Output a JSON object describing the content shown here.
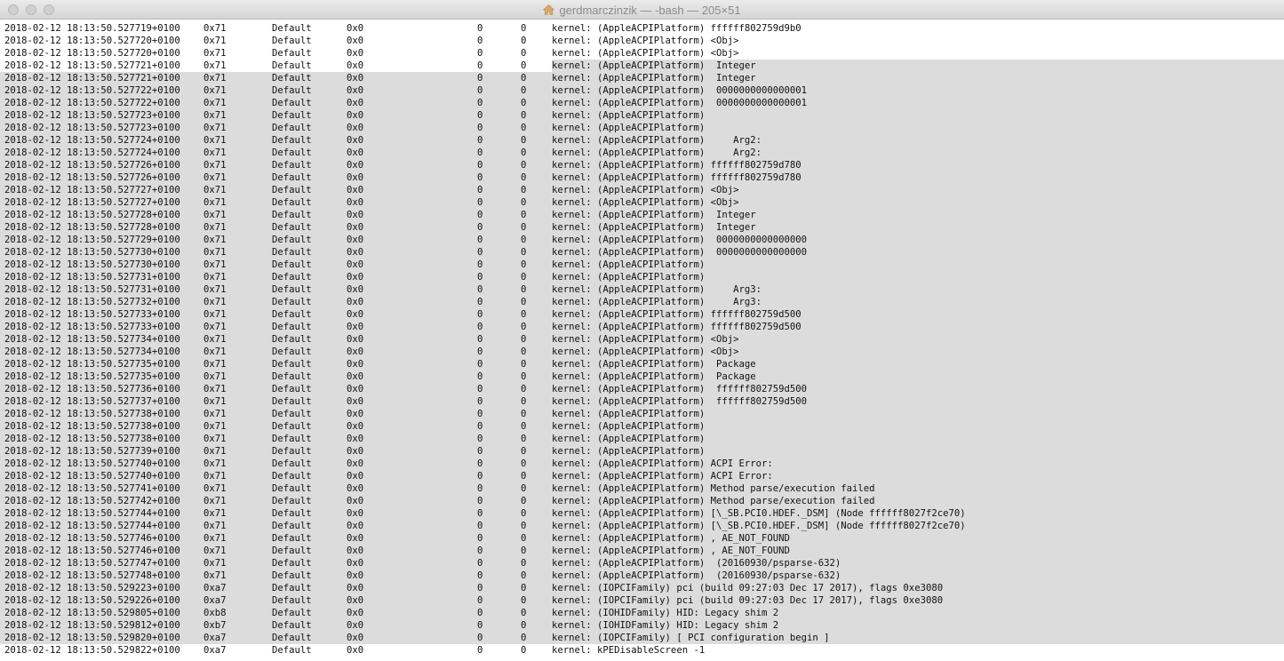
{
  "window": {
    "title": "gerdmarczinzik — -bash — 205×51"
  },
  "terminal": {
    "selection": {
      "partial_lines": [
        3
      ],
      "full_lines_from": 4,
      "full_lines_to": 49
    },
    "lines": [
      [
        "2018-02-12 18:13:50.527719+0100",
        "0x71",
        "Default",
        "0x0",
        "0",
        "0",
        "kernel: (AppleACPIPlatform) ffffff802759d9b0"
      ],
      [
        "2018-02-12 18:13:50.527720+0100",
        "0x71",
        "Default",
        "0x0",
        "0",
        "0",
        "kernel: (AppleACPIPlatform) <Obj>"
      ],
      [
        "2018-02-12 18:13:50.527720+0100",
        "0x71",
        "Default",
        "0x0",
        "0",
        "0",
        "kernel: (AppleACPIPlatform) <Obj>"
      ],
      [
        "2018-02-12 18:13:50.527721+0100",
        "0x71",
        "Default",
        "0x0",
        "0",
        "0",
        "kernel: (AppleACPIPlatform)  Integer"
      ],
      [
        "2018-02-12 18:13:50.527721+0100",
        "0x71",
        "Default",
        "0x0",
        "0",
        "0",
        "kernel: (AppleACPIPlatform)  Integer"
      ],
      [
        "2018-02-12 18:13:50.527722+0100",
        "0x71",
        "Default",
        "0x0",
        "0",
        "0",
        "kernel: (AppleACPIPlatform)  0000000000000001"
      ],
      [
        "2018-02-12 18:13:50.527722+0100",
        "0x71",
        "Default",
        "0x0",
        "0",
        "0",
        "kernel: (AppleACPIPlatform)  0000000000000001"
      ],
      [
        "2018-02-12 18:13:50.527723+0100",
        "0x71",
        "Default",
        "0x0",
        "0",
        "0",
        "kernel: (AppleACPIPlatform)"
      ],
      [
        "2018-02-12 18:13:50.527723+0100",
        "0x71",
        "Default",
        "0x0",
        "0",
        "0",
        "kernel: (AppleACPIPlatform)"
      ],
      [
        "2018-02-12 18:13:50.527724+0100",
        "0x71",
        "Default",
        "0x0",
        "0",
        "0",
        "kernel: (AppleACPIPlatform)     Arg2:"
      ],
      [
        "2018-02-12 18:13:50.527724+0100",
        "0x71",
        "Default",
        "0x0",
        "0",
        "0",
        "kernel: (AppleACPIPlatform)     Arg2:"
      ],
      [
        "2018-02-12 18:13:50.527726+0100",
        "0x71",
        "Default",
        "0x0",
        "0",
        "0",
        "kernel: (AppleACPIPlatform) ffffff802759d780"
      ],
      [
        "2018-02-12 18:13:50.527726+0100",
        "0x71",
        "Default",
        "0x0",
        "0",
        "0",
        "kernel: (AppleACPIPlatform) ffffff802759d780"
      ],
      [
        "2018-02-12 18:13:50.527727+0100",
        "0x71",
        "Default",
        "0x0",
        "0",
        "0",
        "kernel: (AppleACPIPlatform) <Obj>"
      ],
      [
        "2018-02-12 18:13:50.527727+0100",
        "0x71",
        "Default",
        "0x0",
        "0",
        "0",
        "kernel: (AppleACPIPlatform) <Obj>"
      ],
      [
        "2018-02-12 18:13:50.527728+0100",
        "0x71",
        "Default",
        "0x0",
        "0",
        "0",
        "kernel: (AppleACPIPlatform)  Integer"
      ],
      [
        "2018-02-12 18:13:50.527728+0100",
        "0x71",
        "Default",
        "0x0",
        "0",
        "0",
        "kernel: (AppleACPIPlatform)  Integer"
      ],
      [
        "2018-02-12 18:13:50.527729+0100",
        "0x71",
        "Default",
        "0x0",
        "0",
        "0",
        "kernel: (AppleACPIPlatform)  0000000000000000"
      ],
      [
        "2018-02-12 18:13:50.527730+0100",
        "0x71",
        "Default",
        "0x0",
        "0",
        "0",
        "kernel: (AppleACPIPlatform)  0000000000000000"
      ],
      [
        "2018-02-12 18:13:50.527730+0100",
        "0x71",
        "Default",
        "0x0",
        "0",
        "0",
        "kernel: (AppleACPIPlatform)"
      ],
      [
        "2018-02-12 18:13:50.527731+0100",
        "0x71",
        "Default",
        "0x0",
        "0",
        "0",
        "kernel: (AppleACPIPlatform)"
      ],
      [
        "2018-02-12 18:13:50.527731+0100",
        "0x71",
        "Default",
        "0x0",
        "0",
        "0",
        "kernel: (AppleACPIPlatform)     Arg3:"
      ],
      [
        "2018-02-12 18:13:50.527732+0100",
        "0x71",
        "Default",
        "0x0",
        "0",
        "0",
        "kernel: (AppleACPIPlatform)     Arg3:"
      ],
      [
        "2018-02-12 18:13:50.527733+0100",
        "0x71",
        "Default",
        "0x0",
        "0",
        "0",
        "kernel: (AppleACPIPlatform) ffffff802759d500"
      ],
      [
        "2018-02-12 18:13:50.527733+0100",
        "0x71",
        "Default",
        "0x0",
        "0",
        "0",
        "kernel: (AppleACPIPlatform) ffffff802759d500"
      ],
      [
        "2018-02-12 18:13:50.527734+0100",
        "0x71",
        "Default",
        "0x0",
        "0",
        "0",
        "kernel: (AppleACPIPlatform) <Obj>"
      ],
      [
        "2018-02-12 18:13:50.527734+0100",
        "0x71",
        "Default",
        "0x0",
        "0",
        "0",
        "kernel: (AppleACPIPlatform) <Obj>"
      ],
      [
        "2018-02-12 18:13:50.527735+0100",
        "0x71",
        "Default",
        "0x0",
        "0",
        "0",
        "kernel: (AppleACPIPlatform)  Package"
      ],
      [
        "2018-02-12 18:13:50.527735+0100",
        "0x71",
        "Default",
        "0x0",
        "0",
        "0",
        "kernel: (AppleACPIPlatform)  Package"
      ],
      [
        "2018-02-12 18:13:50.527736+0100",
        "0x71",
        "Default",
        "0x0",
        "0",
        "0",
        "kernel: (AppleACPIPlatform)  ffffff802759d500"
      ],
      [
        "2018-02-12 18:13:50.527737+0100",
        "0x71",
        "Default",
        "0x0",
        "0",
        "0",
        "kernel: (AppleACPIPlatform)  ffffff802759d500"
      ],
      [
        "2018-02-12 18:13:50.527738+0100",
        "0x71",
        "Default",
        "0x0",
        "0",
        "0",
        "kernel: (AppleACPIPlatform)"
      ],
      [
        "2018-02-12 18:13:50.527738+0100",
        "0x71",
        "Default",
        "0x0",
        "0",
        "0",
        "kernel: (AppleACPIPlatform)"
      ],
      [
        "2018-02-12 18:13:50.527738+0100",
        "0x71",
        "Default",
        "0x0",
        "0",
        "0",
        "kernel: (AppleACPIPlatform)"
      ],
      [
        "2018-02-12 18:13:50.527739+0100",
        "0x71",
        "Default",
        "0x0",
        "0",
        "0",
        "kernel: (AppleACPIPlatform)"
      ],
      [
        "2018-02-12 18:13:50.527740+0100",
        "0x71",
        "Default",
        "0x0",
        "0",
        "0",
        "kernel: (AppleACPIPlatform) ACPI Error:"
      ],
      [
        "2018-02-12 18:13:50.527740+0100",
        "0x71",
        "Default",
        "0x0",
        "0",
        "0",
        "kernel: (AppleACPIPlatform) ACPI Error:"
      ],
      [
        "2018-02-12 18:13:50.527741+0100",
        "0x71",
        "Default",
        "0x0",
        "0",
        "0",
        "kernel: (AppleACPIPlatform) Method parse/execution failed"
      ],
      [
        "2018-02-12 18:13:50.527742+0100",
        "0x71",
        "Default",
        "0x0",
        "0",
        "0",
        "kernel: (AppleACPIPlatform) Method parse/execution failed"
      ],
      [
        "2018-02-12 18:13:50.527744+0100",
        "0x71",
        "Default",
        "0x0",
        "0",
        "0",
        "kernel: (AppleACPIPlatform) [\\_SB.PCI0.HDEF._DSM] (Node ffffff8027f2ce70)"
      ],
      [
        "2018-02-12 18:13:50.527744+0100",
        "0x71",
        "Default",
        "0x0",
        "0",
        "0",
        "kernel: (AppleACPIPlatform) [\\_SB.PCI0.HDEF._DSM] (Node ffffff8027f2ce70)"
      ],
      [
        "2018-02-12 18:13:50.527746+0100",
        "0x71",
        "Default",
        "0x0",
        "0",
        "0",
        "kernel: (AppleACPIPlatform) , AE_NOT_FOUND"
      ],
      [
        "2018-02-12 18:13:50.527746+0100",
        "0x71",
        "Default",
        "0x0",
        "0",
        "0",
        "kernel: (AppleACPIPlatform) , AE_NOT_FOUND"
      ],
      [
        "2018-02-12 18:13:50.527747+0100",
        "0x71",
        "Default",
        "0x0",
        "0",
        "0",
        "kernel: (AppleACPIPlatform)  (20160930/psparse-632)"
      ],
      [
        "2018-02-12 18:13:50.527748+0100",
        "0x71",
        "Default",
        "0x0",
        "0",
        "0",
        "kernel: (AppleACPIPlatform)  (20160930/psparse-632)"
      ],
      [
        "2018-02-12 18:13:50.529223+0100",
        "0xa7",
        "Default",
        "0x0",
        "0",
        "0",
        "kernel: (IOPCIFamily) pci (build 09:27:03 Dec 17 2017), flags 0xe3080"
      ],
      [
        "2018-02-12 18:13:50.529226+0100",
        "0xa7",
        "Default",
        "0x0",
        "0",
        "0",
        "kernel: (IOPCIFamily) pci (build 09:27:03 Dec 17 2017), flags 0xe3080"
      ],
      [
        "2018-02-12 18:13:50.529805+0100",
        "0xb8",
        "Default",
        "0x0",
        "0",
        "0",
        "kernel: (IOHIDFamily) HID: Legacy shim 2"
      ],
      [
        "2018-02-12 18:13:50.529812+0100",
        "0xb7",
        "Default",
        "0x0",
        "0",
        "0",
        "kernel: (IOHIDFamily) HID: Legacy shim 2"
      ],
      [
        "2018-02-12 18:13:50.529820+0100",
        "0xa7",
        "Default",
        "0x0",
        "0",
        "0",
        "kernel: (IOPCIFamily) [ PCI configuration begin ]"
      ],
      [
        "2018-02-12 18:13:50.529822+0100",
        "0xa7",
        "Default",
        "0x0",
        "0",
        "0",
        "kernel: kPEDisableScreen -1"
      ]
    ]
  }
}
